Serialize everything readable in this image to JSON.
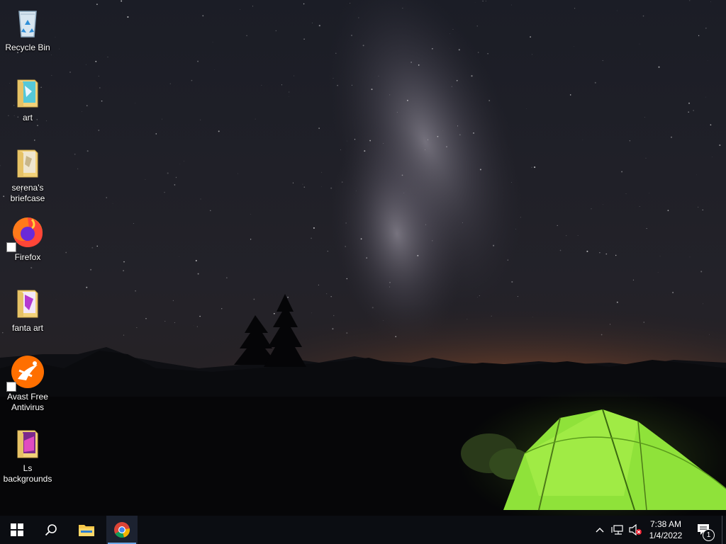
{
  "desktop": {
    "icons": [
      {
        "label": "Recycle Bin",
        "icon": "recycle-bin-icon"
      },
      {
        "label": "art",
        "icon": "folder-icon"
      },
      {
        "label": "serena's briefcase",
        "icon": "folder-icon"
      },
      {
        "label": "Firefox",
        "icon": "firefox-icon"
      },
      {
        "label": "fanta art",
        "icon": "folder-icon"
      },
      {
        "label": "Avast Free Antivirus",
        "icon": "avast-icon"
      },
      {
        "label": "Ls backgrounds",
        "icon": "folder-icon"
      }
    ]
  },
  "taskbar": {
    "pinned": [
      "start-icon",
      "search-icon",
      "file-explorer-icon",
      "chrome-icon"
    ],
    "active_app": "chrome-icon",
    "tray": {
      "time": "7:38 AM",
      "date": "1/4/2022",
      "notification_count": "1",
      "icons": [
        "chevron-up-icon",
        "network-icon",
        "volume-muted-icon"
      ]
    }
  },
  "colors": {
    "taskbar_bg": "#0b0d12",
    "active_indicator": "#6ca7e6",
    "tent_green": "#8fe23a",
    "horizon_glow": "#e07a2a"
  }
}
